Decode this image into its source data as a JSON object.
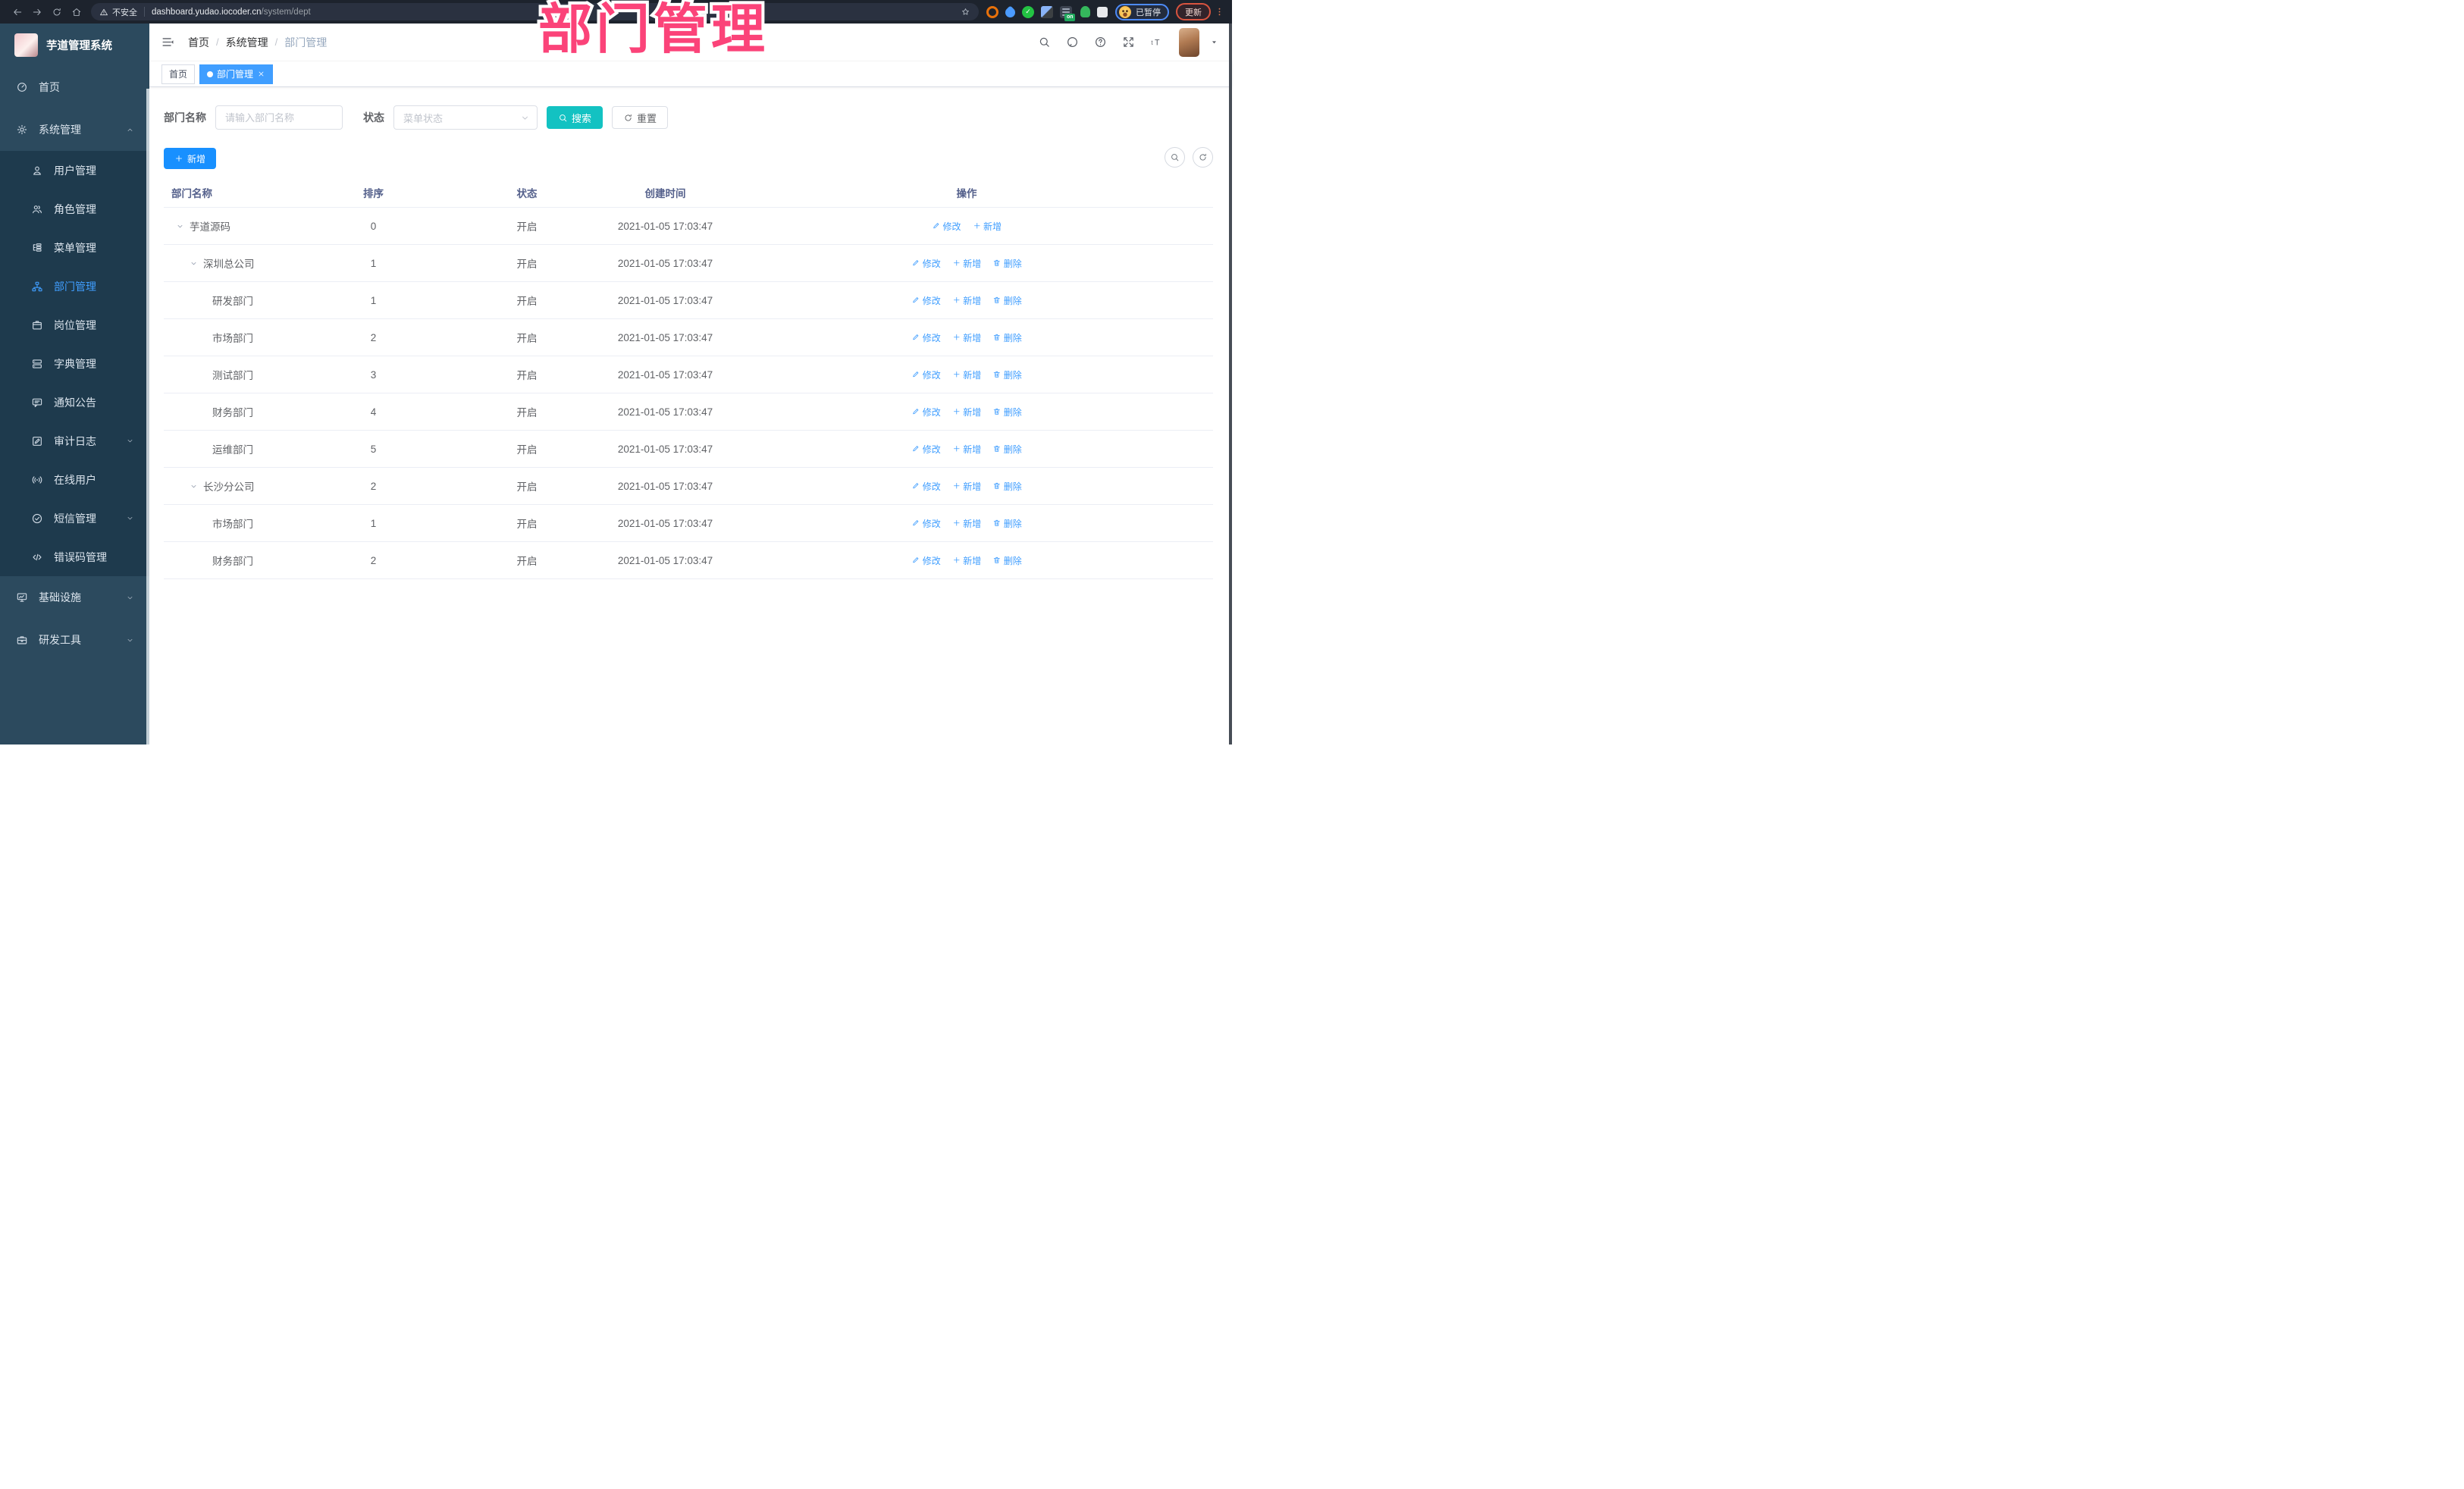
{
  "browser": {
    "security_label": "不安全",
    "url_host": "dashboard.yudao.iocoder.cn",
    "url_path": "/system/dept",
    "profile_status": "已暂停",
    "update_label": "更新"
  },
  "overlay": {
    "title": "部门管理"
  },
  "sidebar": {
    "app_title": "芋道管理系统",
    "items": [
      {
        "key": "home",
        "label": "首页",
        "icon": "dashboard-icon",
        "level": "root"
      },
      {
        "key": "system-management",
        "label": "系统管理",
        "icon": "gear-icon",
        "level": "root",
        "chevron": "up"
      },
      {
        "key": "user-management",
        "label": "用户管理",
        "icon": "user-icon",
        "level": "sub"
      },
      {
        "key": "role-management",
        "label": "角色管理",
        "icon": "users-icon",
        "level": "sub"
      },
      {
        "key": "menu-management",
        "label": "菜单管理",
        "icon": "menu-tree-icon",
        "level": "sub"
      },
      {
        "key": "dept-management",
        "label": "部门管理",
        "icon": "org-tree-icon",
        "level": "sub",
        "active": true
      },
      {
        "key": "post-management",
        "label": "岗位管理",
        "icon": "badge-icon",
        "level": "sub"
      },
      {
        "key": "dict-management",
        "label": "字典管理",
        "icon": "dict-icon",
        "level": "sub"
      },
      {
        "key": "notice-management",
        "label": "通知公告",
        "icon": "announce-icon",
        "level": "sub"
      },
      {
        "key": "audit-log",
        "label": "审计日志",
        "icon": "audit-icon",
        "level": "sub",
        "chevron": "down"
      },
      {
        "key": "online-users",
        "label": "在线用户",
        "icon": "online-icon",
        "level": "sub"
      },
      {
        "key": "sms-management",
        "label": "短信管理",
        "icon": "sms-icon",
        "level": "sub",
        "chevron": "down"
      },
      {
        "key": "error-code-management",
        "label": "错误码管理",
        "icon": "code-icon",
        "level": "sub"
      },
      {
        "key": "infrastructure",
        "label": "基础设施",
        "icon": "infra-icon",
        "level": "root",
        "chevron": "down"
      },
      {
        "key": "dev-tools",
        "label": "研发工具",
        "icon": "tools-icon",
        "level": "root",
        "chevron": "down"
      }
    ]
  },
  "navbar": {
    "breadcrumb": [
      {
        "key": "home",
        "label": "首页",
        "current": false
      },
      {
        "key": "system-management",
        "label": "系统管理",
        "current": false
      },
      {
        "key": "dept-management",
        "label": "部门管理",
        "current": true
      }
    ],
    "icons": [
      "search-icon",
      "github-icon",
      "question-icon",
      "fullscreen-icon",
      "fontsize-icon"
    ]
  },
  "tags": [
    {
      "key": "home",
      "label": "首页",
      "active": false,
      "closable": false
    },
    {
      "key": "dept-management",
      "label": "部门管理",
      "active": true,
      "closable": true
    }
  ],
  "filters": {
    "name_label": "部门名称",
    "name_placeholder": "请输入部门名称",
    "status_label": "状态",
    "status_placeholder": "菜单状态",
    "search_label": "搜索",
    "reset_label": "重置"
  },
  "toolbar": {
    "add_label": "新增"
  },
  "table": {
    "columns": [
      "部门名称",
      "排序",
      "状态",
      "创建时间",
      "操作"
    ],
    "action_labels": {
      "edit": "修改",
      "add": "新增",
      "delete": "删除"
    },
    "rows": [
      {
        "name": "芋道源码",
        "level": 0,
        "expanded": true,
        "sort": "0",
        "status": "开启",
        "created": "2021-01-05 17:03:47",
        "actions": [
          "edit",
          "add"
        ]
      },
      {
        "name": "深圳总公司",
        "level": 1,
        "expanded": true,
        "sort": "1",
        "status": "开启",
        "created": "2021-01-05 17:03:47",
        "actions": [
          "edit",
          "add",
          "delete"
        ]
      },
      {
        "name": "研发部门",
        "level": 2,
        "expanded": false,
        "sort": "1",
        "status": "开启",
        "created": "2021-01-05 17:03:47",
        "actions": [
          "edit",
          "add",
          "delete"
        ]
      },
      {
        "name": "市场部门",
        "level": 2,
        "expanded": false,
        "sort": "2",
        "status": "开启",
        "created": "2021-01-05 17:03:47",
        "actions": [
          "edit",
          "add",
          "delete"
        ]
      },
      {
        "name": "测试部门",
        "level": 2,
        "expanded": false,
        "sort": "3",
        "status": "开启",
        "created": "2021-01-05 17:03:47",
        "actions": [
          "edit",
          "add",
          "delete"
        ]
      },
      {
        "name": "财务部门",
        "level": 2,
        "expanded": false,
        "sort": "4",
        "status": "开启",
        "created": "2021-01-05 17:03:47",
        "actions": [
          "edit",
          "add",
          "delete"
        ]
      },
      {
        "name": "运维部门",
        "level": 2,
        "expanded": false,
        "sort": "5",
        "status": "开启",
        "created": "2021-01-05 17:03:47",
        "actions": [
          "edit",
          "add",
          "delete"
        ]
      },
      {
        "name": "长沙分公司",
        "level": 1,
        "expanded": true,
        "sort": "2",
        "status": "开启",
        "created": "2021-01-05 17:03:47",
        "actions": [
          "edit",
          "add",
          "delete"
        ]
      },
      {
        "name": "市场部门",
        "level": 2,
        "expanded": false,
        "sort": "1",
        "status": "开启",
        "created": "2021-01-05 17:03:47",
        "actions": [
          "edit",
          "add",
          "delete"
        ]
      },
      {
        "name": "财务部门",
        "level": 2,
        "expanded": false,
        "sort": "2",
        "status": "开启",
        "created": "2021-01-05 17:03:47",
        "actions": [
          "edit",
          "add",
          "delete"
        ]
      }
    ]
  },
  "colors": {
    "primary_button": "#1890ff",
    "link_blue": "#409eff",
    "search_teal": "#13c2c2",
    "active_tab": "#409eff",
    "sidebar_bg": "#2c4a5e",
    "submenu_bg": "#1e3a4d",
    "overlay_pink": "#fb4379",
    "browser_bar_bg": "#1d232d"
  }
}
